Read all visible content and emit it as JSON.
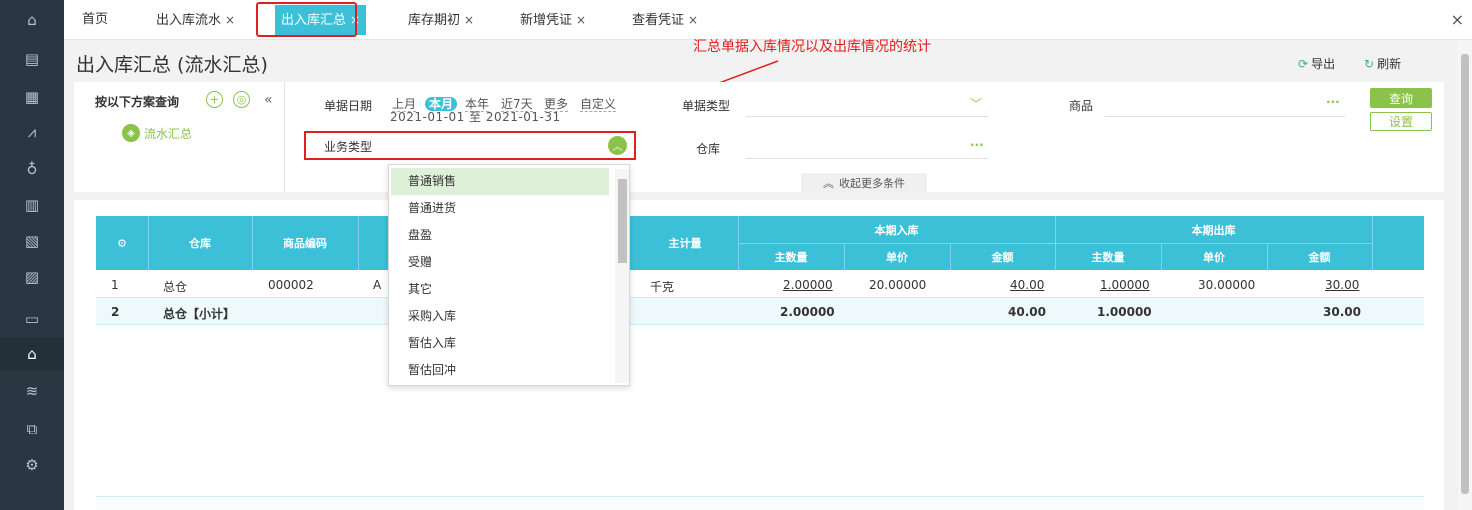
{
  "sidebar": {
    "icons": [
      "home-icon",
      "store-icon",
      "document-icon",
      "chart-icon",
      "money-bag-icon",
      "ledger-icon",
      "report-icon",
      "invoice-icon",
      "wallet-icon",
      "warehouse-icon",
      "stack-icon",
      "voucher-icon",
      "settings-icon"
    ],
    "glyphs": [
      "⌂",
      "▤",
      "▦",
      "⩘",
      "♁",
      "▥",
      "▧",
      "▨",
      "▭",
      "⌂",
      "≋",
      "⧉",
      "⚙"
    ]
  },
  "tabs": [
    {
      "label": "首页",
      "closable": false
    },
    {
      "label": "出入库流水",
      "closable": true
    },
    {
      "label": "出入库汇总",
      "closable": true,
      "active": true
    },
    {
      "label": "库存期初",
      "closable": true
    },
    {
      "label": "新增凭证",
      "closable": true
    },
    {
      "label": "查看凭证",
      "closable": true
    }
  ],
  "tab_close_glyph": "×",
  "page_title": "出入库汇总 (流水汇总)",
  "annotation": "汇总单据入库情况以及出库情况的统计",
  "toolbar": {
    "export_label": "导出",
    "refresh_label": "刷新"
  },
  "filter": {
    "scheme_label": "按以下方案查询",
    "scheme_name": "流水汇总",
    "date_label": "单据日期",
    "quick": [
      "上月",
      "本月",
      "本年",
      "近7天",
      "更多",
      "自定义"
    ],
    "date_range": "2021-01-01 至 2021-01-31",
    "doc_type_label": "单据类型",
    "goods_label": "商品",
    "biz_type_label": "业务类型",
    "warehouse_label": "仓库",
    "more_label": "收起更多条件",
    "query_button": "查询",
    "settings_button": "设置"
  },
  "dropdown": {
    "options": [
      "普通销售",
      "普通进货",
      "盘盈",
      "受赠",
      "其它",
      "采购入库",
      "暂估入库",
      "暂估回冲"
    ],
    "selected": "普通销售"
  },
  "table": {
    "headers": {
      "warehouse": "仓库",
      "code": "商品编码",
      "unit": "主计量",
      "in_group": "本期入库",
      "out_group": "本期出库",
      "qty": "主数量",
      "price": "单价",
      "amount": "金额"
    },
    "rows": [
      {
        "no": "1",
        "warehouse": "总仓",
        "code": "000002",
        "name": "A",
        "unit": "千克",
        "in_qty": "2.00000",
        "in_price": "20.00000",
        "in_amount": "40.00",
        "out_qty": "1.00000",
        "out_price": "30.00000",
        "out_amount": "30.00"
      },
      {
        "no": "2",
        "warehouse": "总仓【小计】",
        "in_qty": "2.00000",
        "in_amount": "40.00",
        "out_qty": "1.00000",
        "out_amount": "30.00"
      }
    ]
  },
  "colors": {
    "accent": "#3cc0d8",
    "green": "#8bc34a",
    "red": "#e02020",
    "sidebar": "#2b3643"
  }
}
